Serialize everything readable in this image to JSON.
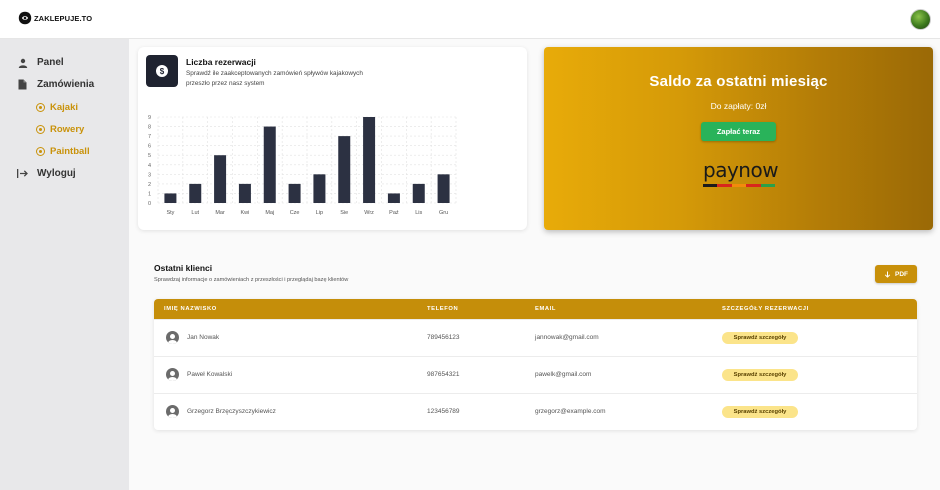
{
  "brand": {
    "name": "ZAKLEPUJE.TO"
  },
  "sidebar": {
    "items": [
      {
        "label": "Panel",
        "icon": "user-icon"
      },
      {
        "label": "Zamówienia",
        "icon": "document-icon"
      },
      {
        "label": "Kajaki",
        "icon": "circle-dot-icon"
      },
      {
        "label": "Rowery",
        "icon": "circle-dot-icon"
      },
      {
        "label": "Paintball",
        "icon": "circle-dot-icon"
      },
      {
        "label": "Wyloguj",
        "icon": "logout-arrow-icon"
      }
    ]
  },
  "chart_card": {
    "title": "Liczba rezerwacji",
    "subtitle": "Sprawdź ile zaakceptowanych zamówień spływów kajakowych przeszło przez nasz system",
    "badge_symbol": "$"
  },
  "chart_data": {
    "type": "bar",
    "categories": [
      "Sty",
      "Lut",
      "Mar",
      "Kwi",
      "Maj",
      "Cze",
      "Lip",
      "Sie",
      "Wrz",
      "Paź",
      "Lis",
      "Gru"
    ],
    "values": [
      1,
      2,
      5,
      2,
      8,
      2,
      3,
      7,
      9,
      1,
      2,
      3
    ],
    "ylim": [
      0,
      9
    ],
    "yticks": [
      0,
      1,
      2,
      3,
      4,
      5,
      6,
      7,
      8,
      9
    ],
    "grid": true,
    "bar_color": "#2c3142"
  },
  "saldo": {
    "title": "Saldo za ostatni miesiąc",
    "amount_text": "Do zapłaty: 0zł",
    "pay_button": "Zapłać teraz",
    "payment_logo": "paynow"
  },
  "clients": {
    "title": "Ostatni klienci",
    "subtitle": "Sprawdzaj informacje o zamówieniach z przeszłości i przeglądaj bazę klientów",
    "pdf_button": "PDF",
    "columns": [
      "IMIĘ NAZWISKO",
      "TELEFON",
      "EMAIL",
      "SZCZEGÓŁY REZERWACJI"
    ],
    "rows": [
      {
        "name": "Jan Nowak",
        "phone": "789456123",
        "email": "jannowak@gmail.com",
        "details": "Sprawdź szczegóły"
      },
      {
        "name": "Paweł Kowalski",
        "phone": "987654321",
        "email": "pawelk@gmail.com",
        "details": "Sprawdź szczegóły"
      },
      {
        "name": "Grzegorz Brzęczyszczykiewicz",
        "phone": "123456789",
        "email": "grzegorz@example.com",
        "details": "Sprawdź szczegóły"
      }
    ]
  },
  "colors": {
    "accent": "#c8900a",
    "success": "#29b35a",
    "dark": "#1f2330"
  }
}
